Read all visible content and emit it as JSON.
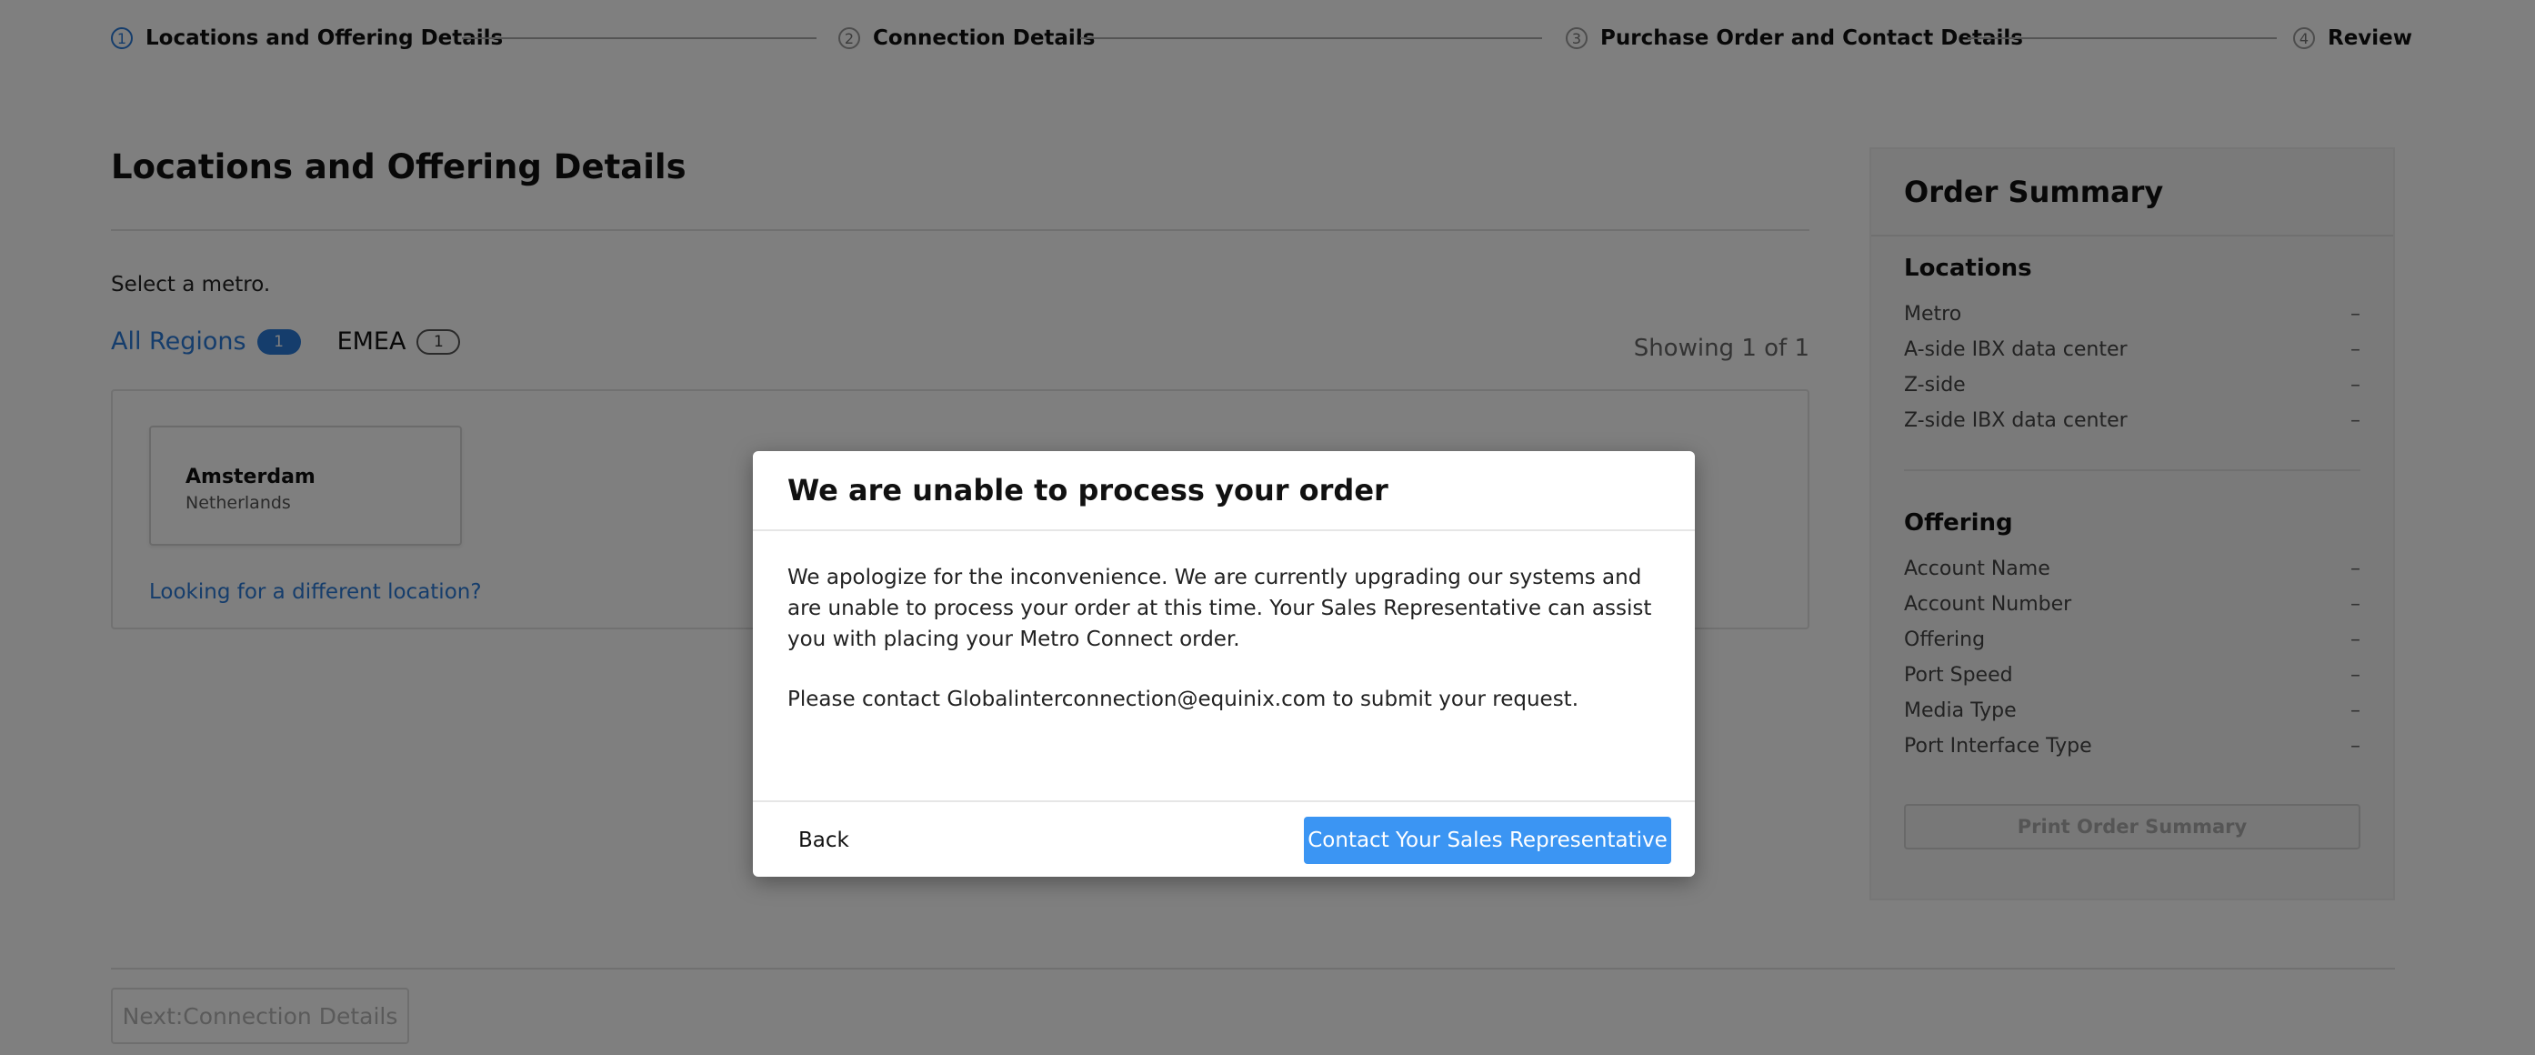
{
  "stepper": {
    "steps": [
      {
        "num": "1",
        "label": "Locations and Offering Details"
      },
      {
        "num": "2",
        "label": "Connection Details"
      },
      {
        "num": "3",
        "label": "Purchase Order and Contact Details"
      },
      {
        "num": "4",
        "label": "Review"
      }
    ]
  },
  "main": {
    "title": "Locations and Offering Details",
    "select_prompt": "Select a metro.",
    "regions": [
      {
        "label": "All Regions",
        "count": "1"
      },
      {
        "label": "EMEA",
        "count": "1"
      }
    ],
    "showing": "Showing 1 of 1",
    "metro": {
      "city": "Amsterdam",
      "country": "Netherlands"
    },
    "different_location_link": "Looking for a different location?",
    "next_button": "Next:Connection Details"
  },
  "summary": {
    "title": "Order Summary",
    "locations_heading": "Locations",
    "locations": [
      {
        "label": "Metro",
        "value": "–"
      },
      {
        "label": "A-side IBX data center",
        "value": "–"
      },
      {
        "label": "Z-side",
        "value": "–"
      },
      {
        "label": "Z-side IBX data center",
        "value": "–"
      }
    ],
    "offering_heading": "Offering",
    "offering": [
      {
        "label": "Account Name",
        "value": "–"
      },
      {
        "label": "Account Number",
        "value": "–"
      },
      {
        "label": "Offering",
        "value": "–"
      },
      {
        "label": "Port Speed",
        "value": "–"
      },
      {
        "label": "Media Type",
        "value": "–"
      },
      {
        "label": "Port Interface Type",
        "value": "–"
      }
    ],
    "print_button": "Print Order Summary"
  },
  "modal": {
    "title": "We are unable to process your order",
    "paragraph1": "We apologize for the inconvenience. We are currently upgrading our systems and are unable to process your order at this time. Your Sales Representative can assist you with placing your Metro Connect order.",
    "paragraph2": "Please contact Globalinterconnection@equinix.com to submit your request.",
    "back_button": "Back",
    "contact_button": "Contact Your Sales Representative"
  },
  "colors": {
    "accent": "#2a7ad8",
    "primary_button": "#3b95f3",
    "overlay": "rgba(0,0,0,0.5)"
  }
}
